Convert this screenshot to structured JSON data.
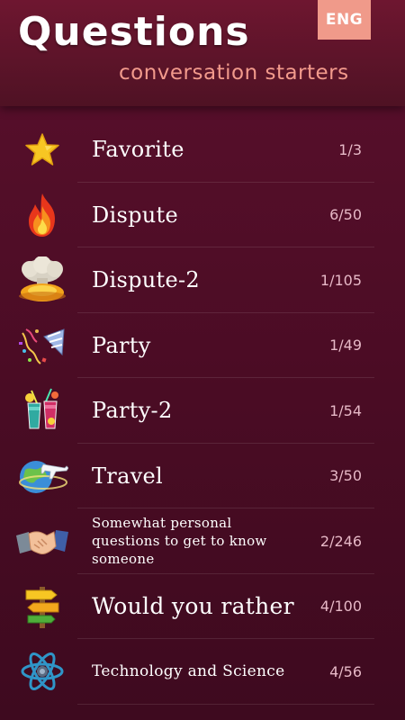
{
  "header": {
    "title": "Questions",
    "subtitle": "conversation starters",
    "language_button": "ENG"
  },
  "categories": [
    {
      "label": "Favorite",
      "count": "1/3",
      "icon": "star-icon"
    },
    {
      "label": "Dispute",
      "count": "6/50",
      "icon": "fire-icon"
    },
    {
      "label": "Dispute-2",
      "count": "1/105",
      "icon": "explosion-icon"
    },
    {
      "label": "Party",
      "count": "1/49",
      "icon": "party-popper-icon"
    },
    {
      "label": "Party-2",
      "count": "1/54",
      "icon": "cocktails-icon"
    },
    {
      "label": "Travel",
      "count": "3/50",
      "icon": "airplane-globe-icon"
    },
    {
      "label": "Somewhat personal questions to get to know someone",
      "count": "2/246",
      "icon": "handshake-icon"
    },
    {
      "label": "Would you rather",
      "count": "4/100",
      "icon": "signpost-icon"
    },
    {
      "label": "Technology and Science",
      "count": "4/56",
      "icon": "atom-icon"
    }
  ],
  "colors": {
    "background": "#4a0c24",
    "header": "#6e1630",
    "accent": "#f09a8a",
    "count_text": "#e7b9c7"
  }
}
